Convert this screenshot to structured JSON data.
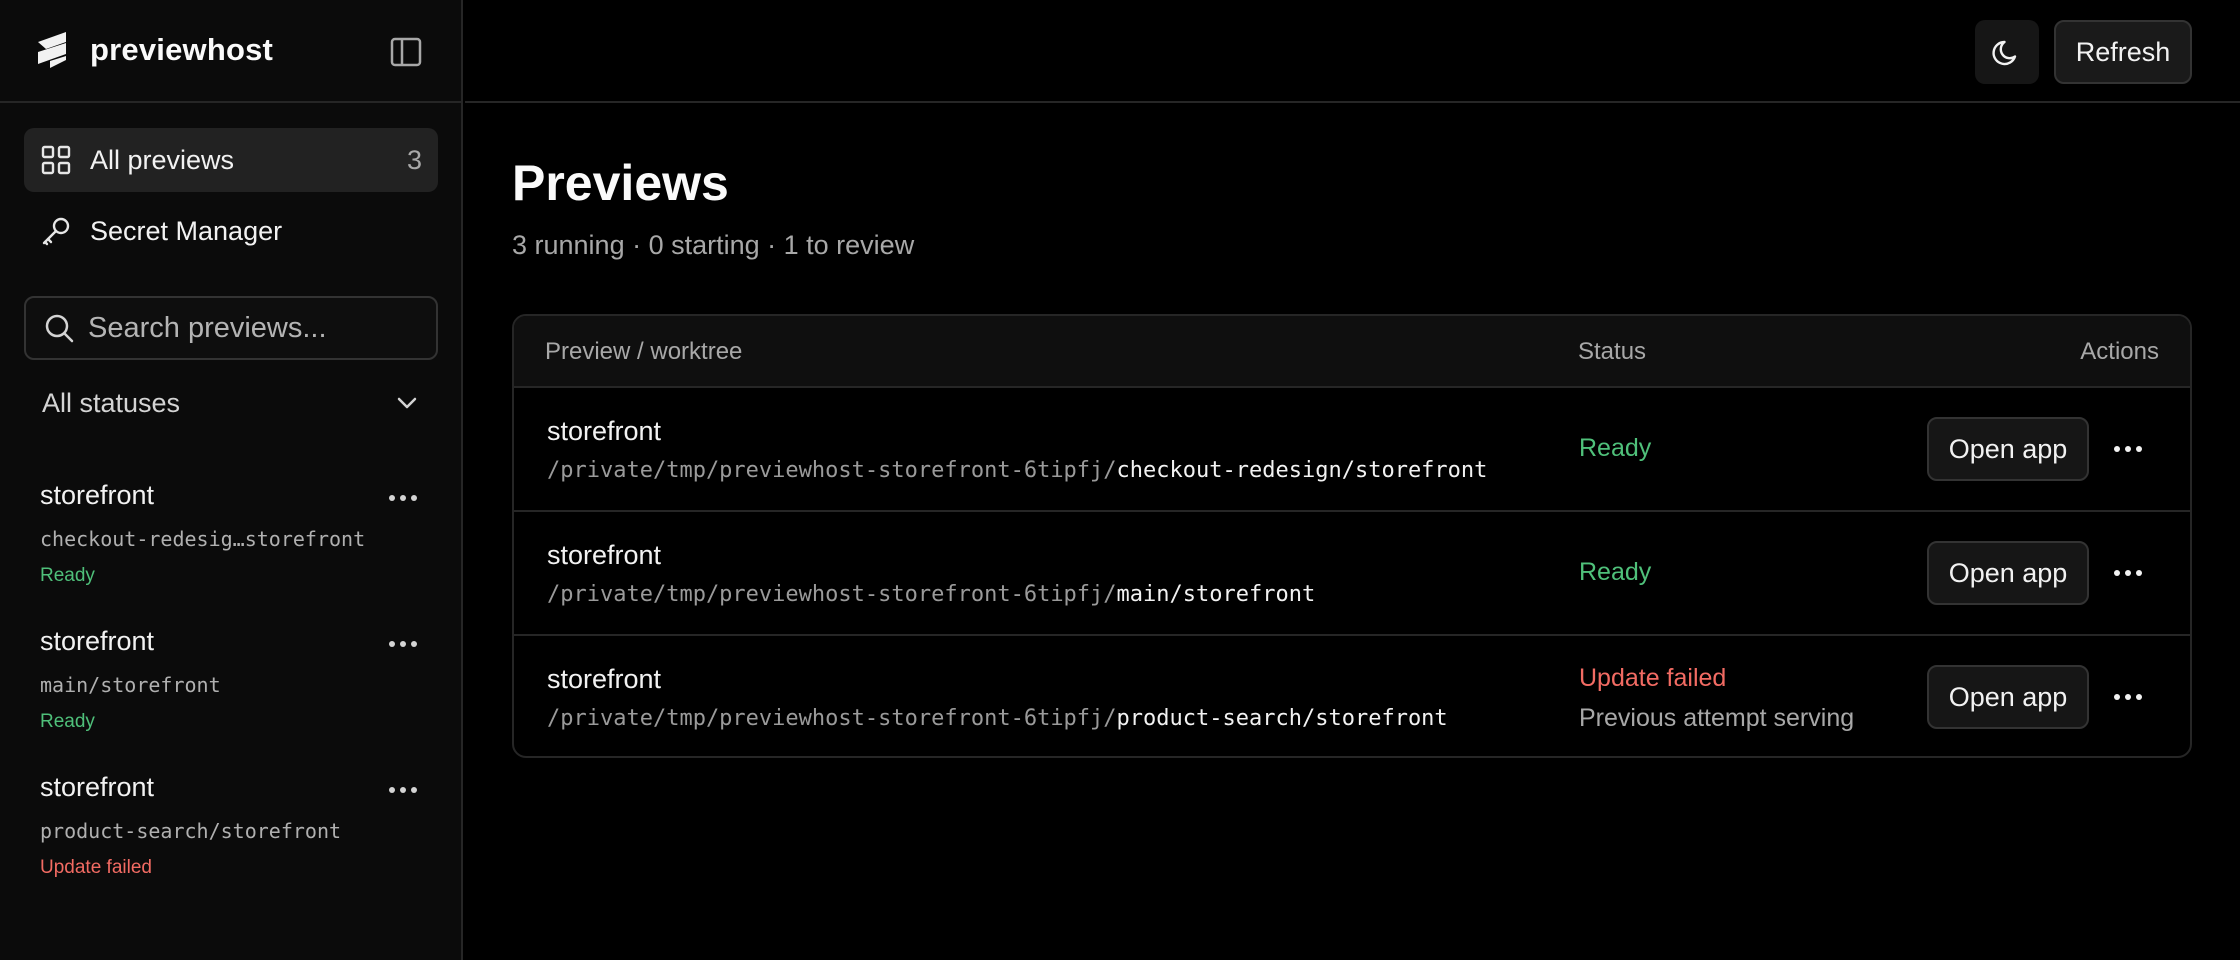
{
  "app": {
    "name": "previewhost"
  },
  "sidebar": {
    "nav": [
      {
        "label": "All previews",
        "count": "3",
        "icon": "grid-icon"
      },
      {
        "label": "Secret Manager",
        "icon": "key-icon"
      }
    ],
    "search": {
      "placeholder": "Search previews..."
    },
    "status_filter": {
      "value": "All statuses"
    },
    "items": [
      {
        "name": "storefront",
        "path": "checkout-redesig…storefront",
        "status": "Ready"
      },
      {
        "name": "storefront",
        "path": "main/storefront",
        "status": "Ready"
      },
      {
        "name": "storefront",
        "path": "product-search/storefront",
        "status": "Update failed"
      }
    ]
  },
  "topbar": {
    "refresh_label": "Refresh"
  },
  "page": {
    "title": "Previews",
    "summary": "3 running · 0 starting · 1 to review"
  },
  "table": {
    "headers": {
      "preview": "Preview / worktree",
      "status": "Status",
      "actions": "Actions"
    },
    "rows": [
      {
        "name": "storefront",
        "path_prefix": "/private/tmp/previewhost-storefront-6tipfj/",
        "path_suffix": "checkout-redesign/storefront",
        "status": "Ready",
        "note": "",
        "action": "Open app"
      },
      {
        "name": "storefront",
        "path_prefix": "/private/tmp/previewhost-storefront-6tipfj/",
        "path_suffix": "main/storefront",
        "status": "Ready",
        "note": "",
        "action": "Open app"
      },
      {
        "name": "storefront",
        "path_prefix": "/private/tmp/previewhost-storefront-6tipfj/",
        "path_suffix": "product-search/storefront",
        "status": "Update failed",
        "note": "Previous attempt serving",
        "action": "Open app"
      }
    ]
  },
  "colors": {
    "ready": "#4fc07a",
    "failed": "#f26b63",
    "background": "#000000",
    "sidebar": "#0b0b0b"
  }
}
